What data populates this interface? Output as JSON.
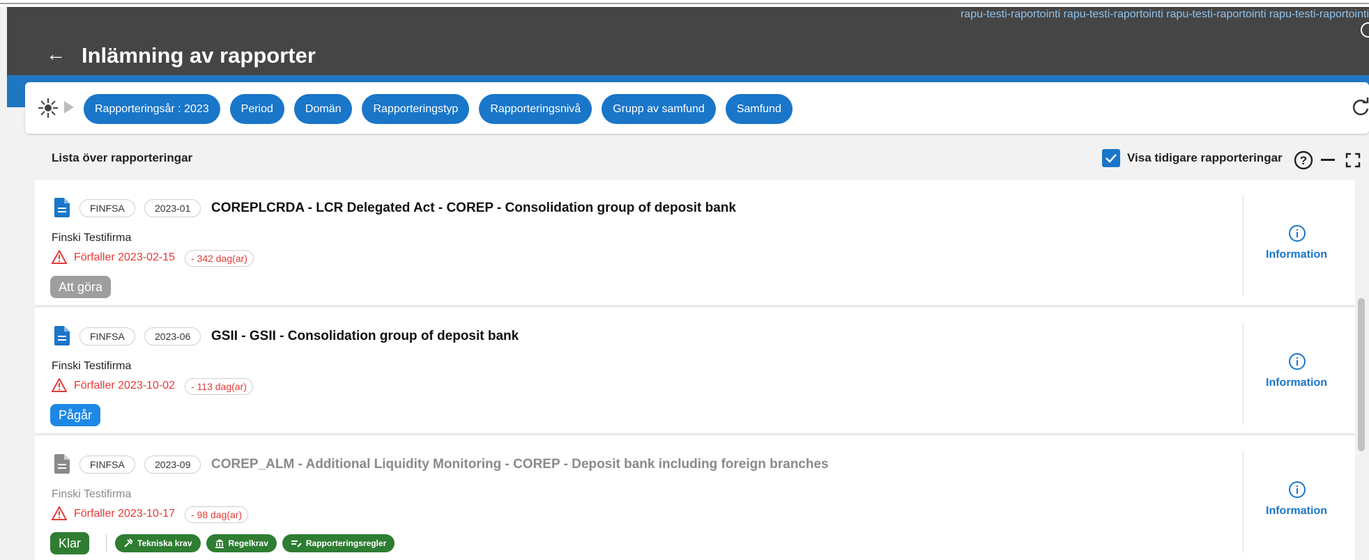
{
  "header": {
    "user_text": "rapu-testi-raportointi rapu-testi-raportointi rapu-testi-raportointi rapu-testi-raportointi",
    "back_glyph": "←",
    "title": "Inlämning av rapporter"
  },
  "filters": {
    "chips": [
      "Rapporteringsår : 2023",
      "Period",
      "Domän",
      "Rapporteringstyp",
      "Rapporteringsnivå",
      "Grupp av samfund",
      "Samfund"
    ]
  },
  "list": {
    "title": "Lista över rapporteringar",
    "show_previous_label": "Visa tidigare rapporteringar",
    "show_previous_checked": true
  },
  "rows": [
    {
      "authority": "FINFSA",
      "period": "2023-01",
      "title": "COREPLCRDA - LCR Delegated Act - COREP - Consolidation group of deposit bank",
      "company": "Finski Testifirma",
      "due": "Förfaller 2023-02-15",
      "days": "- 342 dag(ar)",
      "status": "Att göra",
      "info_label": "Information"
    },
    {
      "authority": "FINFSA",
      "period": "2023-06",
      "title": "GSII - GSII - Consolidation group of deposit bank",
      "company": "Finski Testifirma",
      "due": "Förfaller 2023-10-02",
      "days": "- 113 dag(ar)",
      "status": "Pågår",
      "info_label": "Information"
    },
    {
      "authority": "FINFSA",
      "period": "2023-09",
      "title": "COREP_ALM - Additional Liquidity Monitoring - COREP - Deposit bank including foreign branches",
      "company": "Finski Testifirma",
      "due": "Förfaller 2023-10-17",
      "days": "- 98 dag(ar)",
      "status": "Klar",
      "info_label": "Information",
      "extra_chips": [
        "Tekniska krav",
        "Regelkrav",
        "Rapporteringsregler"
      ]
    }
  ],
  "colors": {
    "header_bg": "#454545",
    "accent_blue": "#1976c9",
    "warning_red": "#e53935",
    "done_green": "#2e7d32",
    "todo_gray": "#9e9e9e"
  }
}
